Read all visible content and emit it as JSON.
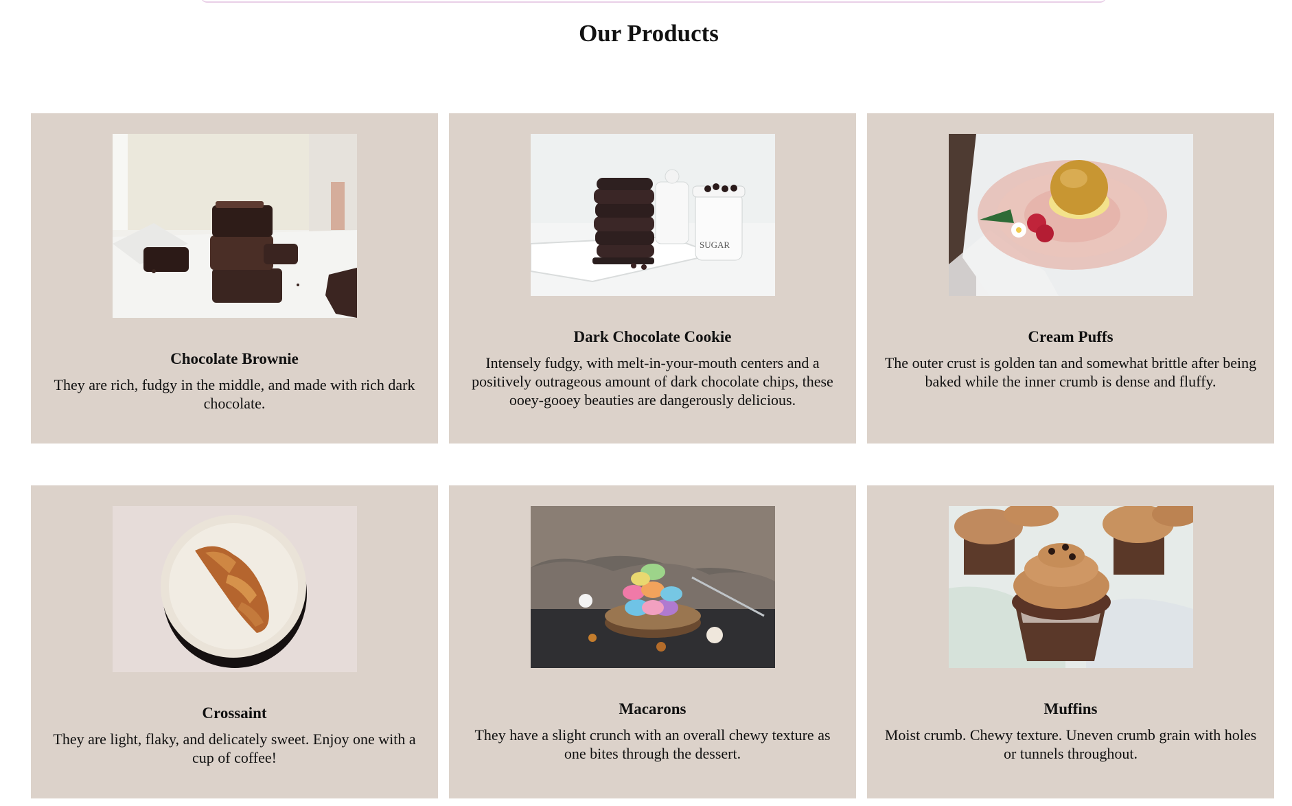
{
  "section": {
    "title": "Our Products"
  },
  "products": [
    {
      "title": "Chocolate Brownie",
      "description": "They are rich, fudgy in the middle, and made with rich dark chocolate.",
      "image_icon": "brownie-image"
    },
    {
      "title": "Dark Chocolate Cookie",
      "description": "Intensely fudgy, with melt-in-your-mouth centers and a positively outrageous amount of dark chocolate chips, these ooey-gooey beauties are dangerously delicious.",
      "image_icon": "cookie-image",
      "jar_label": "SUGAR"
    },
    {
      "title": "Cream Puffs",
      "description": "The outer crust is golden tan and somewhat brittle after being baked while the inner crumb is dense and fluffy.",
      "image_icon": "cream-puff-image"
    },
    {
      "title": "Crossaint",
      "description": "They are light, flaky, and delicately sweet. Enjoy one with a cup of coffee!",
      "image_icon": "croissant-image"
    },
    {
      "title": "Macarons",
      "description": "They have a slight crunch with an overall chewy texture as one bites through the dessert.",
      "image_icon": "macaron-image"
    },
    {
      "title": "Muffins",
      "description": "Moist crumb. Chewy texture. Uneven crumb grain with holes or tunnels throughout.",
      "image_icon": "muffin-image"
    }
  ],
  "colors": {
    "card_background": "#dcd2ca",
    "page_background": "#ffffff",
    "top_bar_border": "#e9cfe7"
  }
}
